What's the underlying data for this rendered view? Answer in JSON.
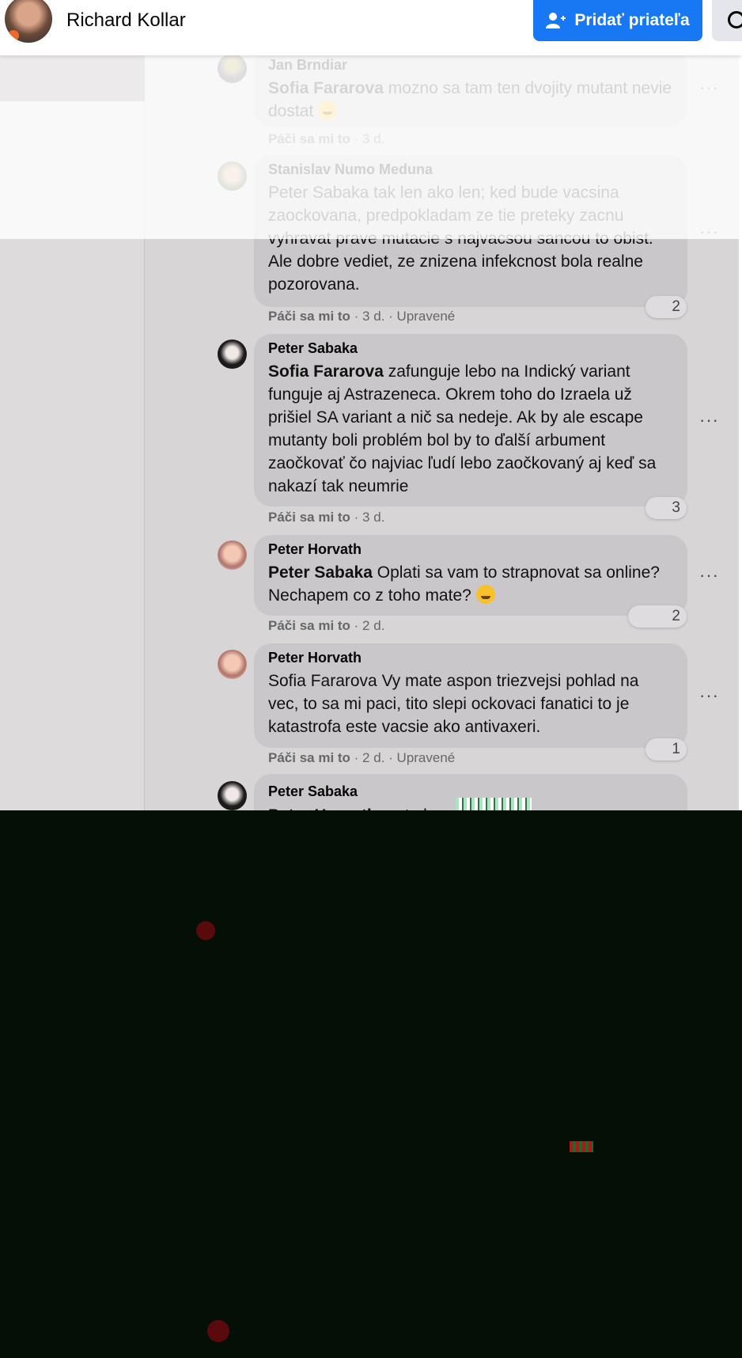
{
  "header": {
    "profile_name": "Richard Kollar",
    "add_friend_label": "Pridať priateľa"
  },
  "comments": [
    {
      "author": "Jan Brndiar",
      "mention": "Sofia Fararova",
      "text": " mozno sa tam ten dvojity mutant nevie dostat ",
      "emoji": "wink-emoji",
      "like_label": "Páči sa mi to",
      "time": "· 3 d.",
      "edited": "",
      "reactions": ""
    },
    {
      "author": "Stanislav Numo Meduna",
      "mention": "",
      "text": "Peter Sabaka tak len ako len; ked bude vacsina zaockovana, predpokladam ze tie preteky zacnu vyhravat prave mutacie s najvacsou sancou to obist. Ale dobre vediet, ze znizena infekcnost bola realne pozorovana.",
      "like_label": "Páči sa mi to",
      "time": "· 3 d.",
      "edited": "· Upravené",
      "reactions": "2"
    },
    {
      "author": "Peter Sabaka",
      "mention": "Sofia Fararova",
      "text": " zafunguje lebo na Indický variant funguje aj Astrazeneca. Okrem toho do Izraela už prišiel SA variant a nič sa nedeje. Ak by ale escape mutanty boli problém bol by to ďalší arbument zaočkovať čo najviac ľudí lebo zaočkovaný aj keď sa nakazí tak neumrie",
      "like_label": "Páči sa mi to",
      "time": "· 3 d.",
      "edited": "",
      "reactions": "3"
    },
    {
      "author": "Peter Horvath",
      "mention": "Peter Sabaka",
      "text": " Oplati sa vam to strapnovat sa online? Nechapem co z toho mate? ",
      "emoji": "grin-emoji",
      "like_label": "Páči sa mi to",
      "time": "· 2 d.",
      "edited": "",
      "reactions": "2"
    },
    {
      "author": "Peter Horvath",
      "mention": "",
      "text": "Sofia Fararova Vy mate aspon triezvejsi pohlad na vec, to sa mi paci, tito slepi ockovaci fanatici to je katastrofa este vacsie ako antivaxeri.",
      "like_label": "Páči sa mi to",
      "time": "· 2 d.",
      "edited": "· Upravené",
      "reactions": "1"
    },
    {
      "author": "Peter Sabaka",
      "mention": "Peter Horvath",
      "text": " no to by"
    }
  ],
  "more_label": "···",
  "colors": {
    "accent": "#1877f2",
    "bubble": "#c9c7c9",
    "meta": "#65676b"
  }
}
